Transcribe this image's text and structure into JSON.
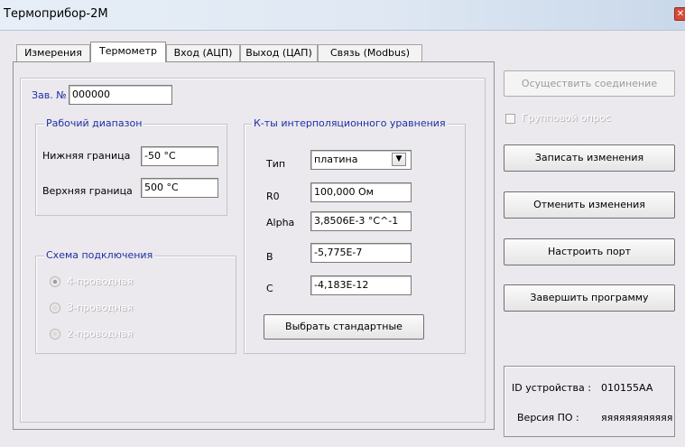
{
  "window": {
    "title": "Термоприбор-2М",
    "close_glyph": "✕"
  },
  "tabs": [
    {
      "label": "Измерения"
    },
    {
      "label": "Термометр"
    },
    {
      "label": "Вход (АЦП)"
    },
    {
      "label": "Выход (ЦАП)"
    },
    {
      "label": "Связь (Modbus)"
    }
  ],
  "serial": {
    "label": "Зав. №",
    "value": "000000"
  },
  "range": {
    "legend": "Рабочий диапазон",
    "lower_label": "Нижняя граница",
    "lower_value": "-50  °C",
    "upper_label": "Верхняя граница",
    "upper_value": "500  °C"
  },
  "wiring": {
    "legend": "Схема подключения",
    "options": [
      "4-проводная",
      "3-проводная",
      "2-проводная"
    ]
  },
  "coeffs": {
    "legend": "К-ты интерполяционного уравнения",
    "type_label": "Тип",
    "type_value": "платина",
    "r0_label": "R0",
    "r0_value": "100,000  Ом",
    "alpha_label": "Alpha",
    "alpha_value": "3,8506E-3  °C^-1",
    "b_label": "B",
    "b_value": "-5,775E-7",
    "c_label": "C",
    "c_value": "-4,183E-12",
    "standard_button": "Выбрать стандартные"
  },
  "actions": {
    "connect": "Осуществить соединение",
    "group_poll": "Групповой опрос",
    "write": "Записать изменения",
    "cancel": "Отменить изменения",
    "port": "Настроить порт",
    "exit": "Завершить программу"
  },
  "device": {
    "id_label": "ID устройства :",
    "id_value": "010155AA",
    "fw_label": "Версия ПО :",
    "fw_value": "яяяяяяяяяяяя"
  },
  "icons": {
    "close": "close-icon",
    "combo": "chevron-down-icon"
  }
}
